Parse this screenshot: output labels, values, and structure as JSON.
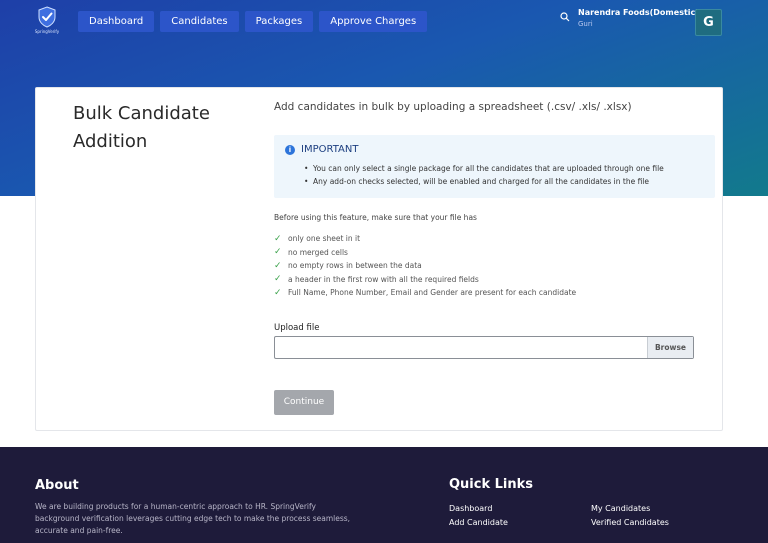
{
  "header": {
    "logo_text": "SpringVerify",
    "nav": [
      "Dashboard",
      "Candidates",
      "Packages",
      "Approve Charges"
    ],
    "company": "Narendra Foods(Domestic)",
    "user": "Guri",
    "avatar_letter": "G"
  },
  "main": {
    "title": "Bulk Candidate Addition",
    "subtitle": "Add candidates in bulk by uploading a spreadsheet (.csv/ .xls/ .xlsx)",
    "important": {
      "title": "IMPORTANT",
      "items": [
        "You can only select a single package for all the candidates that are uploaded through one file",
        "Any add-on checks selected, will be enabled and charged for all the candidates in the file"
      ]
    },
    "requirements_intro": "Before using this feature, make sure that your file has",
    "requirements": [
      "only one sheet in it",
      "no merged cells",
      "no empty rows in between the data",
      "a header in the first row with all the required fields",
      "Full Name, Phone Number, Email and Gender are present for each candidate"
    ],
    "upload_label": "Upload file",
    "upload_value": "",
    "browse_label": "Browse",
    "continue_label": "Continue"
  },
  "footer": {
    "about_title": "About",
    "about_text": "We are building products for a human-centric approach to HR. SpringVerify background verification leverages cutting edge tech to make the process seamless, accurate and pain-free.",
    "quick_links_title": "Quick Links",
    "links": [
      "Dashboard",
      "Add Candidate",
      "My Candidates",
      "Verified Candidates"
    ]
  },
  "colors": {
    "hero_start": "#1e3fa8",
    "hero_end": "#127a8c",
    "nav_button": "#2c55c9",
    "info_bg": "#eef6fc",
    "check": "#3aa14a",
    "footer_bg": "#1e1b3a"
  }
}
